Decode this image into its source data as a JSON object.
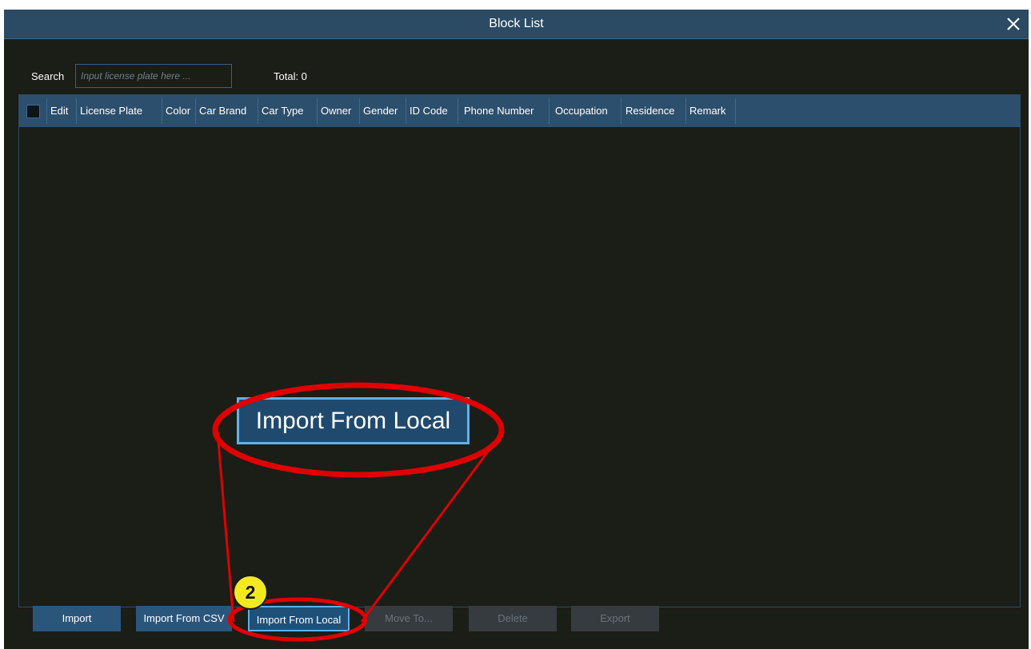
{
  "dialog": {
    "title": "Block List",
    "close_icon": "close-icon"
  },
  "search": {
    "label": "Search",
    "placeholder": "Input license plate here ...",
    "value": ""
  },
  "total": {
    "label": "Total: 0"
  },
  "table": {
    "columns": [
      "Edit",
      "License Plate",
      "Color",
      "Car Brand",
      "Car Type",
      "Owner",
      "Gender",
      "ID Code",
      "Phone Number",
      "Occupation",
      "Residence",
      "Remark"
    ],
    "rows": []
  },
  "buttons": {
    "import": "Import",
    "import_csv": "Import From CSV",
    "import_local": "Import From Local",
    "move_to": "Move To...",
    "delete": "Delete",
    "export": "Export"
  },
  "annotation": {
    "zoom_label": "Import From Local",
    "step_number": "2",
    "highlight_color": "#e00000",
    "badge_color": "#f2ea1f"
  },
  "colors": {
    "titlebar": "#2b4a63",
    "table_header": "#2c4f6d",
    "background": "#1b1d17",
    "focus_border": "#5fb0e8"
  }
}
